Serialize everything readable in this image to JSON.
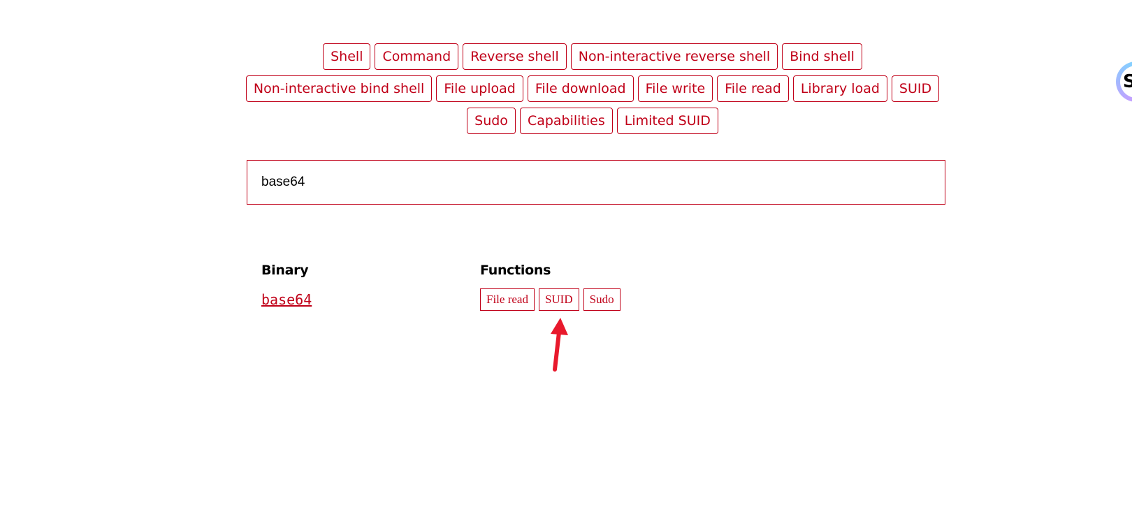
{
  "filters": [
    "Shell",
    "Command",
    "Reverse shell",
    "Non-interactive reverse shell",
    "Bind shell",
    "Non-interactive bind shell",
    "File upload",
    "File download",
    "File write",
    "File read",
    "Library load",
    "SUID",
    "Sudo",
    "Capabilities",
    "Limited SUID"
  ],
  "search": {
    "value": "base64"
  },
  "table": {
    "headers": {
      "binary": "Binary",
      "functions": "Functions"
    },
    "rows": [
      {
        "binary": "base64",
        "functions": [
          "File read",
          "SUID",
          "Sudo"
        ]
      }
    ]
  },
  "annotation": {
    "arrow_color": "#e8192c",
    "target": "SUID"
  },
  "colors": {
    "accent": "#c00018"
  },
  "icons": {
    "corner": "assistant-widget-icon"
  }
}
